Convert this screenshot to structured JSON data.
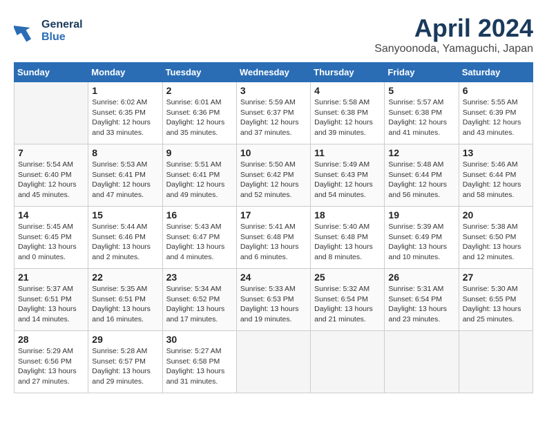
{
  "logo": {
    "line1": "General",
    "line2": "Blue"
  },
  "title": "April 2024",
  "location": "Sanyoonoda, Yamaguchi, Japan",
  "weekdays": [
    "Sunday",
    "Monday",
    "Tuesday",
    "Wednesday",
    "Thursday",
    "Friday",
    "Saturday"
  ],
  "weeks": [
    [
      {
        "day": "",
        "content": ""
      },
      {
        "day": "1",
        "content": "Sunrise: 6:02 AM\nSunset: 6:35 PM\nDaylight: 12 hours\nand 33 minutes."
      },
      {
        "day": "2",
        "content": "Sunrise: 6:01 AM\nSunset: 6:36 PM\nDaylight: 12 hours\nand 35 minutes."
      },
      {
        "day": "3",
        "content": "Sunrise: 5:59 AM\nSunset: 6:37 PM\nDaylight: 12 hours\nand 37 minutes."
      },
      {
        "day": "4",
        "content": "Sunrise: 5:58 AM\nSunset: 6:38 PM\nDaylight: 12 hours\nand 39 minutes."
      },
      {
        "day": "5",
        "content": "Sunrise: 5:57 AM\nSunset: 6:38 PM\nDaylight: 12 hours\nand 41 minutes."
      },
      {
        "day": "6",
        "content": "Sunrise: 5:55 AM\nSunset: 6:39 PM\nDaylight: 12 hours\nand 43 minutes."
      }
    ],
    [
      {
        "day": "7",
        "content": "Sunrise: 5:54 AM\nSunset: 6:40 PM\nDaylight: 12 hours\nand 45 minutes."
      },
      {
        "day": "8",
        "content": "Sunrise: 5:53 AM\nSunset: 6:41 PM\nDaylight: 12 hours\nand 47 minutes."
      },
      {
        "day": "9",
        "content": "Sunrise: 5:51 AM\nSunset: 6:41 PM\nDaylight: 12 hours\nand 49 minutes."
      },
      {
        "day": "10",
        "content": "Sunrise: 5:50 AM\nSunset: 6:42 PM\nDaylight: 12 hours\nand 52 minutes."
      },
      {
        "day": "11",
        "content": "Sunrise: 5:49 AM\nSunset: 6:43 PM\nDaylight: 12 hours\nand 54 minutes."
      },
      {
        "day": "12",
        "content": "Sunrise: 5:48 AM\nSunset: 6:44 PM\nDaylight: 12 hours\nand 56 minutes."
      },
      {
        "day": "13",
        "content": "Sunrise: 5:46 AM\nSunset: 6:44 PM\nDaylight: 12 hours\nand 58 minutes."
      }
    ],
    [
      {
        "day": "14",
        "content": "Sunrise: 5:45 AM\nSunset: 6:45 PM\nDaylight: 13 hours\nand 0 minutes."
      },
      {
        "day": "15",
        "content": "Sunrise: 5:44 AM\nSunset: 6:46 PM\nDaylight: 13 hours\nand 2 minutes."
      },
      {
        "day": "16",
        "content": "Sunrise: 5:43 AM\nSunset: 6:47 PM\nDaylight: 13 hours\nand 4 minutes."
      },
      {
        "day": "17",
        "content": "Sunrise: 5:41 AM\nSunset: 6:48 PM\nDaylight: 13 hours\nand 6 minutes."
      },
      {
        "day": "18",
        "content": "Sunrise: 5:40 AM\nSunset: 6:48 PM\nDaylight: 13 hours\nand 8 minutes."
      },
      {
        "day": "19",
        "content": "Sunrise: 5:39 AM\nSunset: 6:49 PM\nDaylight: 13 hours\nand 10 minutes."
      },
      {
        "day": "20",
        "content": "Sunrise: 5:38 AM\nSunset: 6:50 PM\nDaylight: 13 hours\nand 12 minutes."
      }
    ],
    [
      {
        "day": "21",
        "content": "Sunrise: 5:37 AM\nSunset: 6:51 PM\nDaylight: 13 hours\nand 14 minutes."
      },
      {
        "day": "22",
        "content": "Sunrise: 5:35 AM\nSunset: 6:51 PM\nDaylight: 13 hours\nand 16 minutes."
      },
      {
        "day": "23",
        "content": "Sunrise: 5:34 AM\nSunset: 6:52 PM\nDaylight: 13 hours\nand 17 minutes."
      },
      {
        "day": "24",
        "content": "Sunrise: 5:33 AM\nSunset: 6:53 PM\nDaylight: 13 hours\nand 19 minutes."
      },
      {
        "day": "25",
        "content": "Sunrise: 5:32 AM\nSunset: 6:54 PM\nDaylight: 13 hours\nand 21 minutes."
      },
      {
        "day": "26",
        "content": "Sunrise: 5:31 AM\nSunset: 6:54 PM\nDaylight: 13 hours\nand 23 minutes."
      },
      {
        "day": "27",
        "content": "Sunrise: 5:30 AM\nSunset: 6:55 PM\nDaylight: 13 hours\nand 25 minutes."
      }
    ],
    [
      {
        "day": "28",
        "content": "Sunrise: 5:29 AM\nSunset: 6:56 PM\nDaylight: 13 hours\nand 27 minutes."
      },
      {
        "day": "29",
        "content": "Sunrise: 5:28 AM\nSunset: 6:57 PM\nDaylight: 13 hours\nand 29 minutes."
      },
      {
        "day": "30",
        "content": "Sunrise: 5:27 AM\nSunset: 6:58 PM\nDaylight: 13 hours\nand 31 minutes."
      },
      {
        "day": "",
        "content": ""
      },
      {
        "day": "",
        "content": ""
      },
      {
        "day": "",
        "content": ""
      },
      {
        "day": "",
        "content": ""
      }
    ]
  ]
}
